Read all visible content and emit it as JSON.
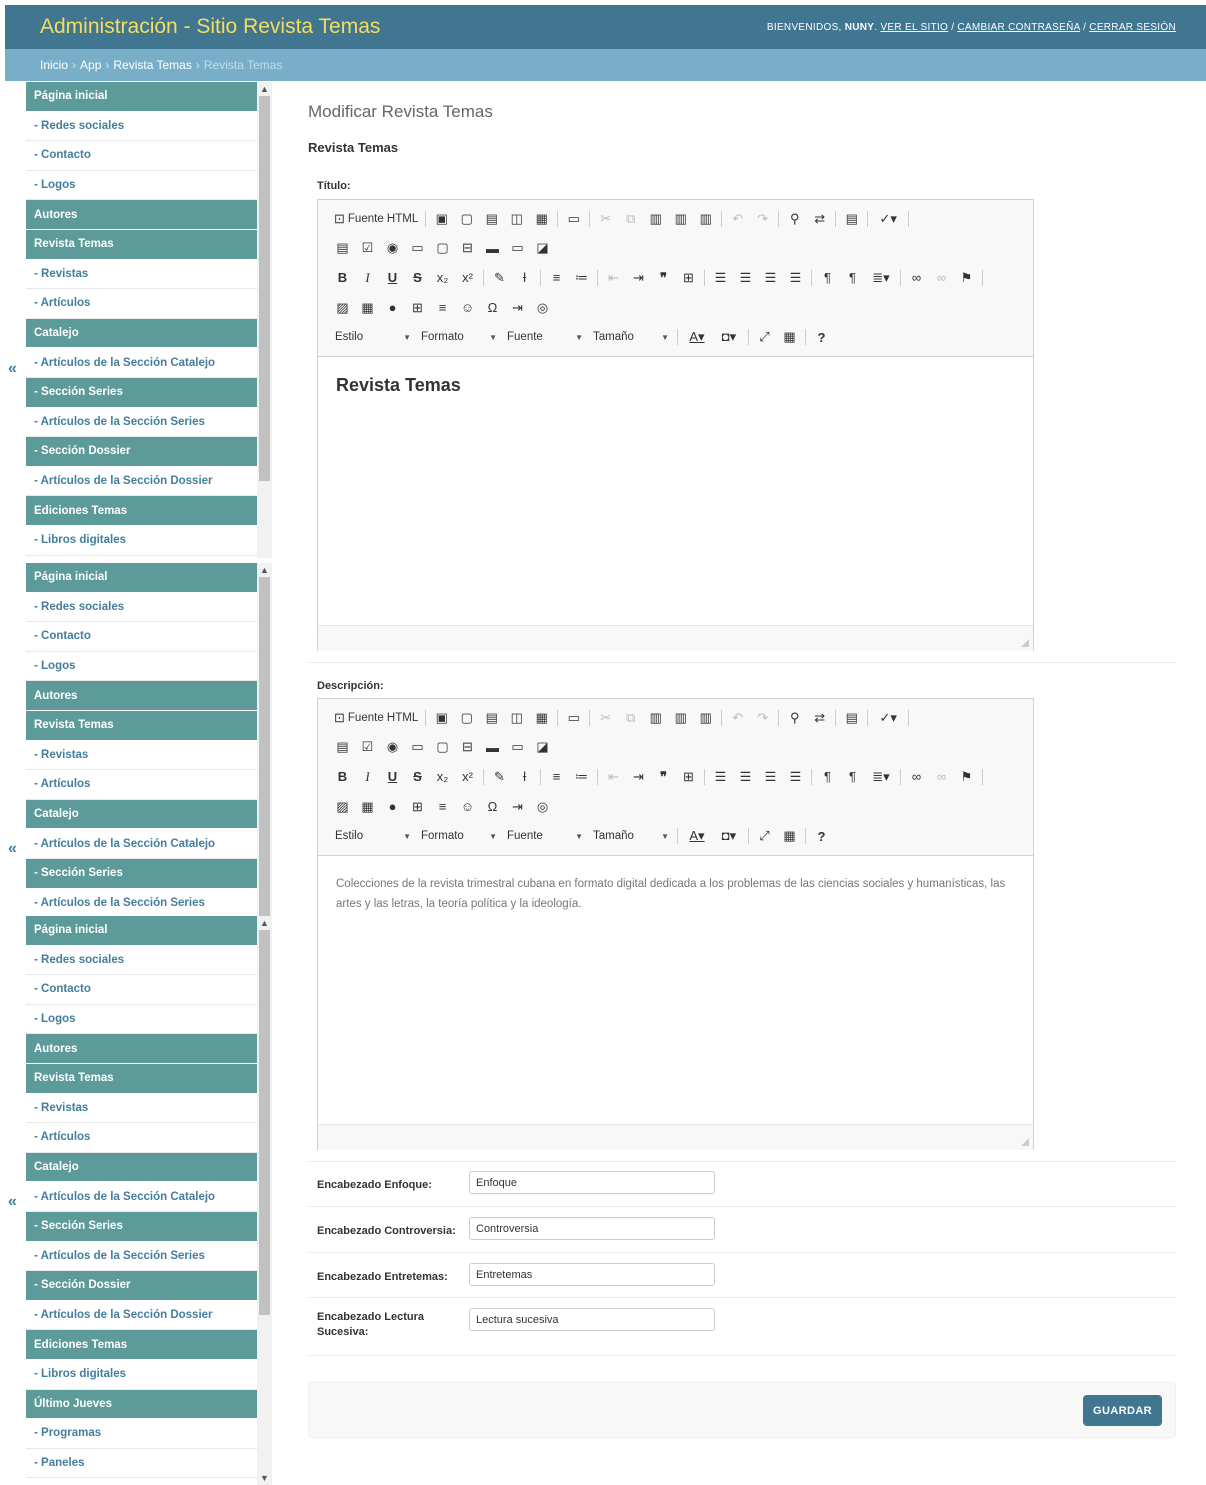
{
  "header": {
    "site_name": "Administración - Sitio Revista Temas",
    "welcome": "BIENVENIDOS, ",
    "username": "NUNY",
    "dot": ". ",
    "view_site": "VER EL SITIO",
    "slash1": " / ",
    "change_password": "CAMBIAR CONTRASEÑA",
    "slash2": " / ",
    "logout": "CERRAR SESIÓN"
  },
  "breadcrumbs": {
    "home": "Inicio",
    "app": "App",
    "model": "Revista Temas",
    "current": "Revista Temas",
    "sep": "›"
  },
  "sidebar_toggle": "«",
  "sidebar1": [
    {
      "label": "Página inicial",
      "kind": "hdr"
    },
    {
      "label": "- Redes sociales",
      "kind": "sub"
    },
    {
      "label": "- Contacto",
      "kind": "sub"
    },
    {
      "label": "- Logos",
      "kind": "sub"
    },
    {
      "label": "Autores",
      "kind": "hdr"
    },
    {
      "label": "Revista Temas",
      "kind": "hdr"
    },
    {
      "label": "- Revistas",
      "kind": "sub"
    },
    {
      "label": "- Artículos",
      "kind": "sub"
    },
    {
      "label": "Catalejo",
      "kind": "hdr"
    },
    {
      "label": "- Artículos de la Sección Catalejo",
      "kind": "sub"
    },
    {
      "label": "- Sección Series",
      "kind": "subhdr"
    },
    {
      "label": "- Artículos de la Sección Series",
      "kind": "sub"
    },
    {
      "label": "- Sección Dossier",
      "kind": "subhdr"
    },
    {
      "label": "- Artículos de la Sección Dossier",
      "kind": "sub"
    },
    {
      "label": "Ediciones Temas",
      "kind": "hdr"
    },
    {
      "label": "- Libros digitales",
      "kind": "sub"
    }
  ],
  "sidebar2": [
    {
      "label": "Página inicial",
      "kind": "hdr"
    },
    {
      "label": "- Redes sociales",
      "kind": "sub"
    },
    {
      "label": "- Contacto",
      "kind": "sub"
    },
    {
      "label": "- Logos",
      "kind": "sub"
    },
    {
      "label": "Autores",
      "kind": "hdr"
    },
    {
      "label": "Revista Temas",
      "kind": "hdr"
    },
    {
      "label": "- Revistas",
      "kind": "sub"
    },
    {
      "label": "- Artículos",
      "kind": "sub"
    },
    {
      "label": "Catalejo",
      "kind": "hdr"
    },
    {
      "label": "- Artículos de la Sección Catalejo",
      "kind": "sub"
    },
    {
      "label": "- Sección Series",
      "kind": "subhdr"
    },
    {
      "label": "- Artículos de la Sección Series",
      "kind": "sub"
    }
  ],
  "sidebar3": [
    {
      "label": "Página inicial",
      "kind": "hdr"
    },
    {
      "label": "- Redes sociales",
      "kind": "sub"
    },
    {
      "label": "- Contacto",
      "kind": "sub"
    },
    {
      "label": "- Logos",
      "kind": "sub"
    },
    {
      "label": "Autores",
      "kind": "hdr"
    },
    {
      "label": "Revista Temas",
      "kind": "hdr"
    },
    {
      "label": "- Revistas",
      "kind": "sub"
    },
    {
      "label": "- Artículos",
      "kind": "sub"
    },
    {
      "label": "Catalejo",
      "kind": "hdr"
    },
    {
      "label": "- Artículos de la Sección Catalejo",
      "kind": "sub"
    },
    {
      "label": "- Sección Series",
      "kind": "subhdr"
    },
    {
      "label": "- Artículos de la Sección Series",
      "kind": "sub"
    },
    {
      "label": "- Sección Dossier",
      "kind": "subhdr"
    },
    {
      "label": "- Artículos de la Sección Dossier",
      "kind": "sub"
    },
    {
      "label": "Ediciones Temas",
      "kind": "hdr"
    },
    {
      "label": "- Libros digitales",
      "kind": "sub"
    },
    {
      "label": "Último Jueves",
      "kind": "hdr"
    },
    {
      "label": "- Programas",
      "kind": "sub"
    },
    {
      "label": "- Paneles",
      "kind": "sub"
    }
  ],
  "form": {
    "page_title": "Modificar Revista Temas",
    "model_name": "Revista Temas",
    "titulo_label": "Título:",
    "titulo_content": "Revista Temas",
    "descripcion_label": "Descripción:",
    "descripcion_content": "Colecciones de la revista trimestral cubana en formato digital dedicada a los problemas de las ciencias sociales y humanísticas, las artes y las letras, la teoría política y la ideología.",
    "enfoque_label": "Encabezado Enfoque:",
    "enfoque_value": "Enfoque",
    "controversia_label": "Encabezado Controversia:",
    "controversia_value": "Controversia",
    "entretemas_label": "Encabezado Entretemas:",
    "entretemas_value": "Entretemas",
    "lectura_label": "Encabezado Lectura Sucesiva:",
    "lectura_value": "Lectura sucesiva",
    "save_label": "GUARDAR"
  },
  "toolbar": {
    "source_label": "Fuente HTML",
    "style_label": "Estilo",
    "format_label": "Formato",
    "font_label": "Fuente",
    "size_label": "Tamaño",
    "help_label": "?",
    "bold": "B",
    "italic": "I",
    "underline": "U",
    "strike": "S",
    "quote": "❞"
  },
  "colors": {
    "header_bg": "#417690",
    "site_name": "#f5dd5d",
    "breadcrumbs_bg": "#79aec8",
    "sidebar_header_bg": "#5d9a9a",
    "link": "#447e9b",
    "save_button_bg": "#417690"
  }
}
